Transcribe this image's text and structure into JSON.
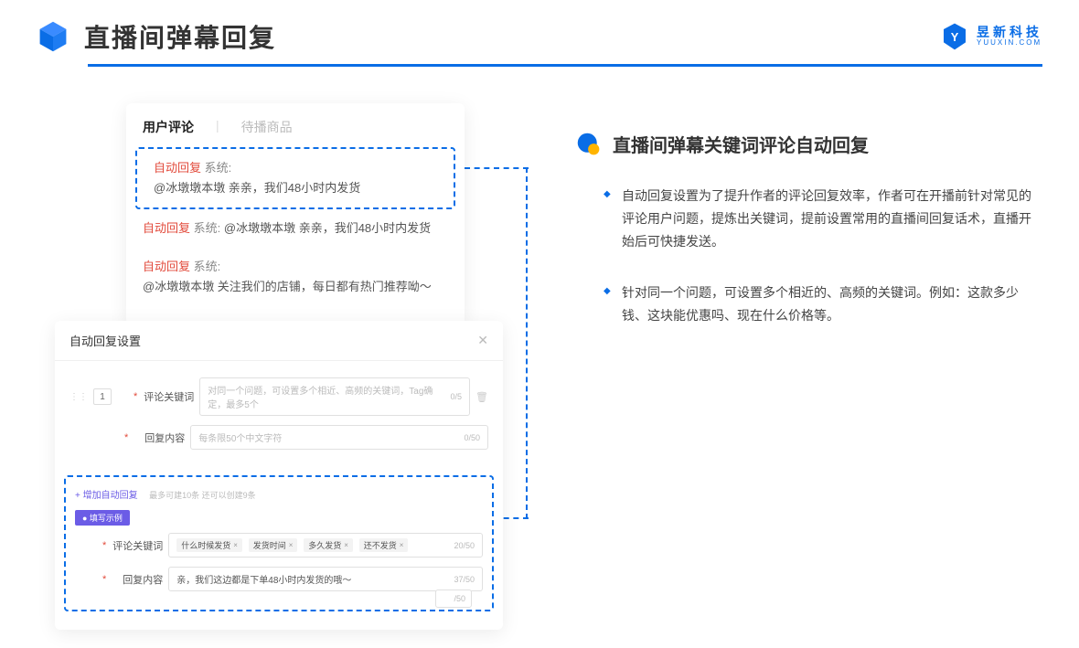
{
  "header": {
    "title": "直播间弹幕回复",
    "brand_cn": "昱新科技",
    "brand_en": "YUUXIN.COM"
  },
  "comments": {
    "tab_active": "用户评论",
    "tab_inactive": "待播商品",
    "rows": [
      {
        "tag": "自动回复",
        "sys": "系统:",
        "text": "@冰墩墩本墩 亲亲，我们48小时内发货"
      },
      {
        "tag": "自动回复",
        "sys": "系统:",
        "text": "@冰墩墩本墩 亲亲，我们48小时内发货"
      },
      {
        "tag": "自动回复",
        "sys": "系统:",
        "text": "@冰墩墩本墩 关注我们的店铺，每日都有热门推荐呦～"
      }
    ]
  },
  "settings": {
    "title": "自动回复设置",
    "row_number": "1",
    "field_keyword": "评论关键词",
    "keyword_placeholder": "对同一个问题，可设置多个相近、高频的关键词，Tag确定，最多5个",
    "keyword_count": "0/5",
    "field_reply": "回复内容",
    "reply_placeholder": "每条限50个中文字符",
    "reply_count": "0/50",
    "add_link": "+ 增加自动回复",
    "add_hint": "最多可建10条 还可以创建9条",
    "example_badge": "● 填写示例",
    "example_keyword_label": "评论关键词",
    "example_tags": [
      "什么时候发货",
      "发货时间",
      "多久发货",
      "还不发货"
    ],
    "example_keyword_count": "20/50",
    "example_reply_label": "回复内容",
    "example_reply_text": "亲，我们这边都是下单48小时内发货的哦～",
    "example_reply_count": "37/50",
    "ghost_count": "/50"
  },
  "right": {
    "section_title": "直播间弹幕关键词评论自动回复",
    "bullets": [
      "自动回复设置为了提升作者的评论回复效率，作者可在开播前针对常见的评论用户问题，提炼出关键词，提前设置常用的直播间回复话术，直播开始后可快捷发送。",
      "针对同一个问题，可设置多个相近的、高频的关键词。例如：这款多少钱、这块能优惠吗、现在什么价格等。"
    ]
  }
}
